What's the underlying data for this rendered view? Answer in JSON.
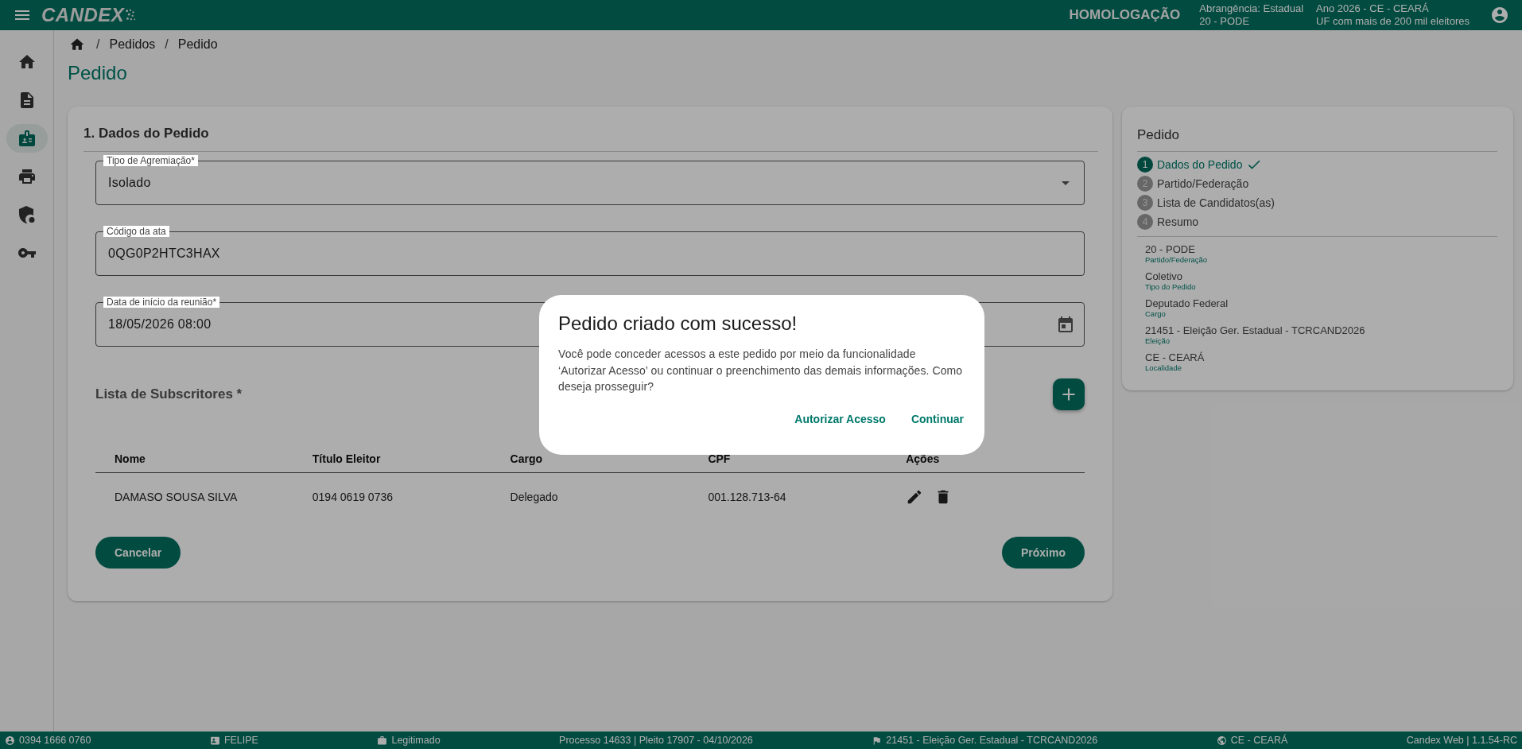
{
  "header": {
    "logo": "CANDEX",
    "environment": "HOMOLOGAÇÃO",
    "info": [
      {
        "line1": "Abrangência: Estadual",
        "line2": "20 - PODE"
      },
      {
        "line1": "Ano 2026 - CE - CEARÁ",
        "line2": "UF com mais de 200 mil eleitores"
      }
    ]
  },
  "sidebar": {
    "items": [
      {
        "selected": false
      },
      {
        "selected": false
      },
      {
        "selected": true
      },
      {
        "selected": false
      },
      {
        "selected": false
      },
      {
        "selected": false
      }
    ]
  },
  "breadcrumb": [
    {
      "separator": "/",
      "label": "Pedidos"
    },
    {
      "separator": "/",
      "label": "Pedido"
    }
  ],
  "page_title": "Pedido",
  "form": {
    "section_title": "1. Dados do Pedido",
    "fields": [
      {
        "kind": "select",
        "label": "Tipo de Agremiação*",
        "value": "Isolado"
      },
      {
        "kind": "text",
        "label": "Código da ata",
        "value": "0QG0P2HTC3HAX"
      },
      {
        "kind": "date",
        "label": "Data de início da reunião*",
        "value": "18/05/2026 08:00"
      }
    ],
    "list_title": "Lista de Subscritores *",
    "table": {
      "columns": [
        "Nome",
        "Título Eleitor",
        "Cargo",
        "CPF",
        "Ações"
      ],
      "rows": [
        {
          "cells": [
            "DAMASO SOUSA SILVA",
            "0194 0619 0736",
            "Delegado",
            "001.128.713-64"
          ]
        }
      ]
    },
    "buttons": {
      "cancel": "Cancelar",
      "next": "Próximo"
    }
  },
  "summary": {
    "title": "Pedido",
    "steps": [
      {
        "number": "1",
        "label": "Dados do Pedido",
        "selected": true,
        "completed": true
      },
      {
        "number": "2",
        "label": "Partido/Federação",
        "selected": false,
        "completed": false
      },
      {
        "number": "3",
        "label": "Lista de Candidatos(as)",
        "selected": false,
        "completed": false
      },
      {
        "number": "4",
        "label": "Resumo",
        "selected": false,
        "completed": false
      }
    ],
    "items": [
      {
        "value": "20 - PODE",
        "label": "Partido/Federação"
      },
      {
        "value": "Coletivo",
        "label": "Tipo do Pedido"
      },
      {
        "value": "Deputado Federal",
        "label": "Cargo"
      },
      {
        "value": "21451 - Eleição Ger. Estadual - TCRCAND2026",
        "label": "Eleição"
      },
      {
        "value": "CE - CEARÁ",
        "label": "Localidade"
      }
    ]
  },
  "dialog": {
    "title": "Pedido criado com sucesso!",
    "message": "Você pode conceder acessos a este pedido por meio da funcionalidade ‘Autorizar Acesso’ ou continuar o preenchimento das demais informações. Como deseja prosseguir?",
    "buttons": [
      "Autorizar Acesso",
      "Continuar"
    ]
  },
  "status_bar": [
    "0394 1666 0760",
    "FELIPE",
    "Legitimado",
    "Processo 14633 | Pleito 17907 - 04/10/2026",
    "21451 - Eleição Ger. Estadual - TCRCAND2026",
    "CE - CEARÁ",
    "Candex Web | 1.1.54-RC"
  ]
}
